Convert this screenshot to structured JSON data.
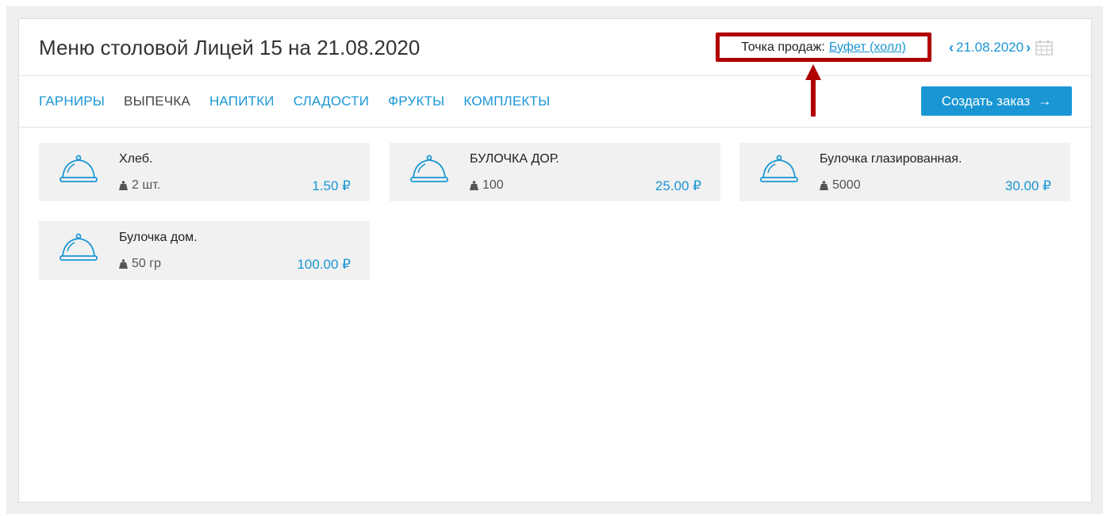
{
  "title": "Меню столовой Лицей 15 на 21.08.2020",
  "sale_point": {
    "label": "Точка продаж:",
    "value": "Буфет (холл)"
  },
  "date_nav": {
    "prev": "‹",
    "date": "21.08.2020",
    "next": "›",
    "calendar_icon": "calendar-icon"
  },
  "tabs": [
    {
      "label": "ГАРНИРЫ",
      "active": false
    },
    {
      "label": "ВЫПЕЧКА",
      "active": true
    },
    {
      "label": "НАПИТКИ",
      "active": false
    },
    {
      "label": "СЛАДОСТИ",
      "active": false
    },
    {
      "label": "ФРУКТЫ",
      "active": false
    },
    {
      "label": "КОМПЛЕКТЫ",
      "active": false
    }
  ],
  "create_order": {
    "label": "Создать заказ",
    "icon": "→"
  },
  "items": [
    {
      "name": "Хлеб.",
      "weight": "2 шт.",
      "price": "1.50 ₽"
    },
    {
      "name": "БУЛОЧКА ДОР.",
      "weight": "100",
      "price": "25.00 ₽"
    },
    {
      "name": "Булочка глазированная.",
      "weight": "5000",
      "price": "30.00 ₽"
    },
    {
      "name": "Булочка дом.",
      "weight": "50 гр",
      "price": "100.00 ₽"
    }
  ],
  "colors": {
    "accent": "#1a96d4",
    "highlight": "#b00000",
    "card_bg": "#f1f1f1"
  }
}
